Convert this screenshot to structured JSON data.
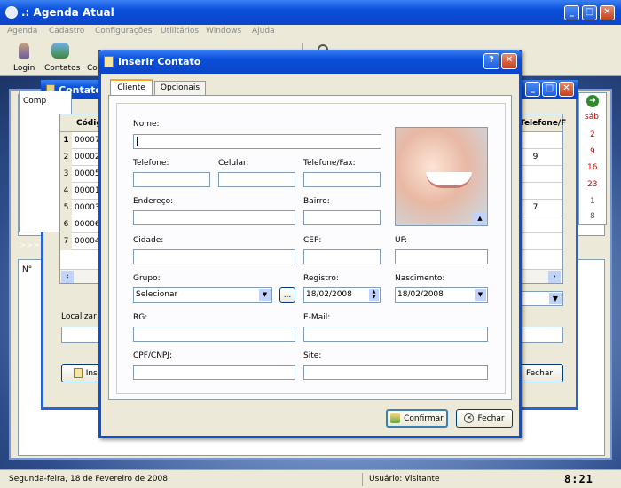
{
  "app": {
    "title": ".: Agenda Atual"
  },
  "menu": [
    "Agenda",
    "Cadastro",
    "Configurações",
    "Utilitários",
    "Windows",
    "Ajuda"
  ],
  "toolbar": {
    "login": "Login",
    "contatos": "Contatos",
    "co": "Co"
  },
  "contatos_window": {
    "title": "Contatos",
    "comp_label": "Comp",
    "grid_header": "Códig",
    "rows": [
      {
        "n": "1",
        "code": "00007"
      },
      {
        "n": "2",
        "code": "00002"
      },
      {
        "n": "3",
        "code": "00005"
      },
      {
        "n": "4",
        "code": "00001"
      },
      {
        "n": "5",
        "code": "00003"
      },
      {
        "n": "6",
        "code": "00006"
      },
      {
        "n": "7",
        "code": "00004"
      }
    ],
    "right_header": "Telefone/F",
    "right_vals": [
      "9",
      "",
      "",
      "7",
      "",
      "",
      ""
    ],
    "localizar": "Localizar P",
    "inserir": "Inse",
    "fechar": "Fechar"
  },
  "calendar": {
    "header": "sáb",
    "days": [
      "2",
      "9",
      "16",
      "23",
      "1",
      "8"
    ]
  },
  "bottom_panel": {
    "arrows": ">>>>",
    "col": "N°"
  },
  "dialog": {
    "title": "Inserir Contato",
    "tabs": [
      "Cliente",
      "Opcionais"
    ],
    "labels": {
      "nome": "Nome:",
      "telefone": "Telefone:",
      "celular": "Celular:",
      "fax": "Telefone/Fax:",
      "endereco": "Endereço:",
      "bairro": "Bairro:",
      "cidade": "Cidade:",
      "cep": "CEP:",
      "uf": "UF:",
      "grupo": "Grupo:",
      "registro": "Registro:",
      "nascimento": "Nascimento:",
      "rg": "RG:",
      "email": "E-Mail:",
      "cpf": "CPF/CNPJ:",
      "site": "Site:"
    },
    "values": {
      "grupo": "Selecionar",
      "registro": "18/02/2008",
      "nascimento": "18/02/2008",
      "ellipsis": "..."
    },
    "buttons": {
      "confirmar": "Confirmar",
      "fechar": "Fechar"
    }
  },
  "statusbar": {
    "date": "Segunda-feira, 18 de Fevereiro de 2008",
    "user": "Usuário: Visitante",
    "clock": "8:21"
  }
}
